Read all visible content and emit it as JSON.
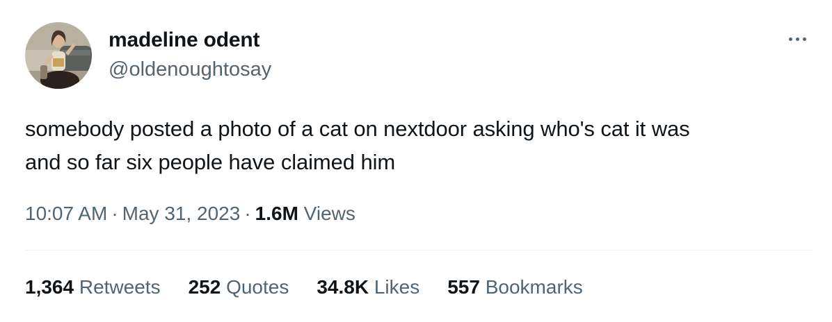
{
  "author": {
    "display_name": "madeline odent",
    "handle": "@oldenoughtosay"
  },
  "tweet": {
    "text_lines": [
      "somebody posted a photo of a cat on nextdoor asking who's cat it was",
      "and so far six people have claimed him"
    ],
    "time": "10:07 AM",
    "date": "May 31, 2023",
    "separator": "·",
    "views_count": "1.6M",
    "views_label": "Views"
  },
  "stats": {
    "retweets": {
      "count": "1,364",
      "label": "Retweets"
    },
    "quotes": {
      "count": "252",
      "label": "Quotes"
    },
    "likes": {
      "count": "34.8K",
      "label": "Likes"
    },
    "bookmarks": {
      "count": "557",
      "label": "Bookmarks"
    }
  },
  "icons": {
    "more": "more-horizontal-icon"
  },
  "colors": {
    "text_primary": "#0f1419",
    "text_secondary": "#536471",
    "divider": "#eff3f4",
    "background": "#ffffff"
  }
}
